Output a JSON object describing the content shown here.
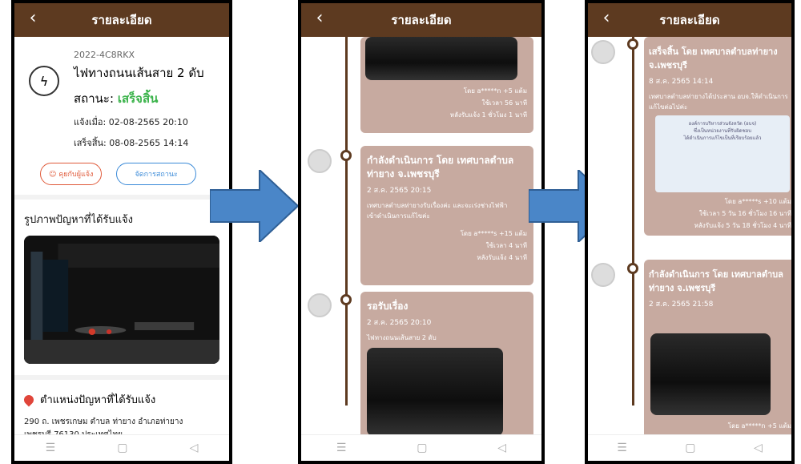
{
  "header": {
    "title": "รายละเอียด",
    "back_icon": "chevron-left-icon"
  },
  "screen1": {
    "code": "2022-4C8RKX",
    "report_title": "ไฟทางถนนเส้นสาย 2 ดับ",
    "status_label": "สถานะ:",
    "status_value": "เสร็จสิ้น",
    "reported_at": "แจ้งเมื่อ: 02-08-2565 20:10",
    "finished_at": "เสร็จสิ้น: 08-08-2565 14:14",
    "chat_button": "คุยกับผู้แจ้ง",
    "manage_button": "จัดการสถานะ",
    "photo_section": "รูปภาพปัญหาที่ได้รับแจ้ง",
    "location_section": "ตำแหน่งปัญหาที่ได้รับแจ้ง",
    "address_line1": "290 ถ. เพชรเกษม ตำบล ท่ายาง อำเภอท่ายาง",
    "address_line2": "เพชรบุรี 76130 ประเทศไทย",
    "status_color": "#3ab34a"
  },
  "screen2": {
    "card1_meta1": "โดย a*****n +5 แต้ม",
    "card1_meta2": "ใช้เวลา 56 นาที",
    "card1_meta3": "หลังรับแจ้ง 1 ชั่วโมง 1 นาที",
    "card2_title1": "กำลังดำเนินการ โดย  เทศบาลตำบล",
    "card2_title2": "ท่ายาง จ.เพชรบุรี",
    "card2_date": "2 ส.ค. 2565 20:15",
    "card2_body1": "เทศบาลตำบลท่ายางรับเรื่องค่ะ และจะเร่งช่างไฟฟ้า",
    "card2_body2": "เข้าดำเนินการแก้ไขค่ะ",
    "card2_meta1": "โดย a*****s +15 แต้ม",
    "card2_meta2": "ใช้เวลา 4 นาที",
    "card2_meta3": "หลังรับแจ้ง 4 นาที",
    "card3_title": "รอรับเรื่อง",
    "card3_date": "2 ส.ค. 2565 20:10",
    "card3_body": "ไฟทางถนนเส้นสาย 2 ดับ"
  },
  "screen3": {
    "card1_title1": "เสร็จสิ้น โดย  เทศบาลตำบลท่ายาง",
    "card1_title2": "จ.เพชรบุรี",
    "card1_date": "8 ส.ค. 2565 14:14",
    "card1_body1": "เทศบาลตำบลท่ายางได้ประสาน อบจ.ให้ดำเนินการ",
    "card1_body2": "แก้ไขต่อไปค่ะ",
    "doc_line1": "องค์การบริหารส่วนจังหวัด (อบจ)",
    "doc_line2": "ซึ่งเป็นหน่วยงานที่รับผิดชอบ",
    "doc_line3": "ได้ดำเนินการแก้ไขเป็นที่เรียบร้อยแล้ว",
    "card1_meta1": "โดย a*****s +10 แต้ม",
    "card1_meta2": "ใช้เวลา 5 วัน 16 ชั่วโมง 16 นาที",
    "card1_meta3": "หลังรับแจ้ง 5 วัน 18 ชั่วโมง 4 นาที",
    "card2_title1": "กำลังดำเนินการ โดย  เทศบาลตำบล",
    "card2_title2": "ท่ายาง จ.เพชรบุรี",
    "card2_date": "2 ส.ค. 2565 21:58",
    "card2_meta1": "โดย a*****n +5 แต้ม"
  },
  "colors": {
    "appbar": "#5d3a20",
    "card": "#c7aaa0",
    "arrow": "#4a86c8"
  }
}
